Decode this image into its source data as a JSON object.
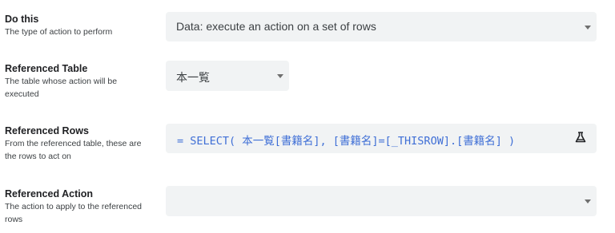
{
  "fields": {
    "do_this": {
      "title": "Do this",
      "description": "The type of action to perform",
      "value": "Data: execute an action on a set of rows"
    },
    "referenced_table": {
      "title": "Referenced Table",
      "description": "The table whose action will be executed",
      "value": "本一覧"
    },
    "referenced_rows": {
      "title": "Referenced Rows",
      "description": "From the referenced table, these are the rows to act on",
      "formula": "= SELECT( 本一覧[書籍名], [書籍名]=[_THISROW].[書籍名] )"
    },
    "referenced_action": {
      "title": "Referenced Action",
      "description": "The action to apply to the referenced rows",
      "value": ""
    }
  },
  "icons": {
    "dropdown": "chevron-down-icon",
    "expression": "flask-icon"
  },
  "colors": {
    "field_bg": "#f1f3f4",
    "formula_text": "#3f6fd6"
  }
}
